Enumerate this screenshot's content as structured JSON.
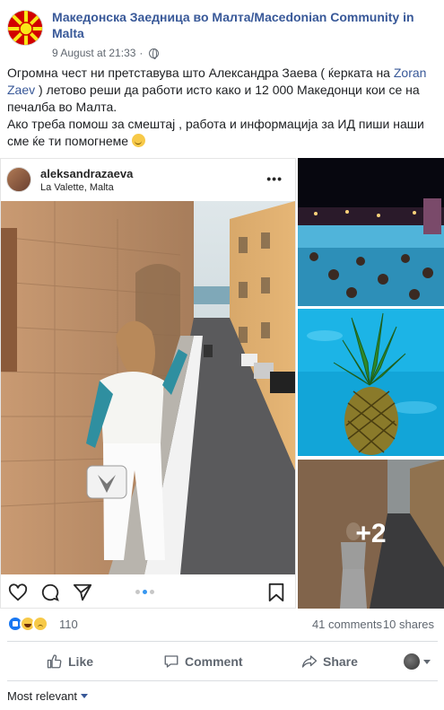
{
  "post": {
    "page_name": "Македонска Заедница во Малта/Macedonian Community in Malta",
    "timestamp": "9 August at 21:33",
    "privacy_icon": "globe-icon",
    "text_part1": "Огромна чест ни претставува што Александра Заева ( ќерката на ",
    "text_link": "Zoran Zaev",
    "text_part2": " ) летово реши да работи исто како и 12 000 Македонци кои се на печалба во Малта.",
    "text_part3": "Ако треба помош за смештај , работа и информација за ИД пиши наши сме ќе ти помогнеме "
  },
  "instagram": {
    "username": "aleksandrazaeva",
    "location": "La Valette, Malta",
    "more_icon": "more-dots-icon",
    "carousel_active": 2,
    "carousel_total": 3
  },
  "gallery": {
    "more_label": "+2"
  },
  "stats": {
    "reaction_count": "110",
    "comments": "41 comments",
    "shares": "10 shares"
  },
  "actions": {
    "like": "Like",
    "comment": "Comment",
    "share": "Share"
  },
  "comments_filter": {
    "label": "Most relevant"
  },
  "colors": {
    "link": "#385898",
    "text": "#1c1e21",
    "muted": "#606770"
  }
}
